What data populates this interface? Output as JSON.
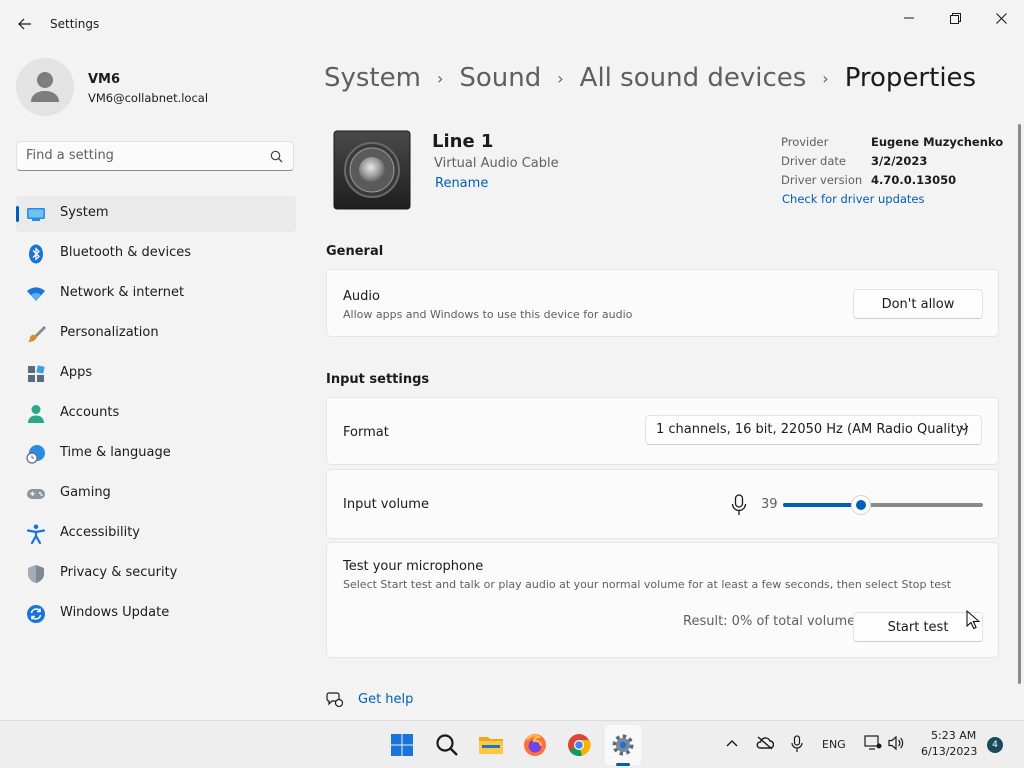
{
  "window": {
    "title": "Settings"
  },
  "profile": {
    "name": "VM6",
    "email": "VM6@collabnet.local"
  },
  "search": {
    "placeholder": "Find a setting"
  },
  "sidebar": {
    "items": [
      {
        "label": "System",
        "icon": "system-icon",
        "active": true
      },
      {
        "label": "Bluetooth & devices",
        "icon": "bluetooth-icon"
      },
      {
        "label": "Network & internet",
        "icon": "wifi-icon"
      },
      {
        "label": "Personalization",
        "icon": "brush-icon"
      },
      {
        "label": "Apps",
        "icon": "apps-icon"
      },
      {
        "label": "Accounts",
        "icon": "accounts-icon"
      },
      {
        "label": "Time & language",
        "icon": "globe-clock-icon"
      },
      {
        "label": "Gaming",
        "icon": "gamepad-icon"
      },
      {
        "label": "Accessibility",
        "icon": "accessibility-icon"
      },
      {
        "label": "Privacy & security",
        "icon": "shield-icon"
      },
      {
        "label": "Windows Update",
        "icon": "update-icon"
      }
    ]
  },
  "breadcrumb": {
    "items": [
      "System",
      "Sound",
      "All sound devices",
      "Properties"
    ],
    "separator": "›"
  },
  "device": {
    "name": "Line 1",
    "type": "Virtual Audio Cable",
    "rename_label": "Rename",
    "info": {
      "provider_label": "Provider",
      "provider_value": "Eugene Muzychenko",
      "date_label": "Driver date",
      "date_value": "3/2/2023",
      "version_label": "Driver version",
      "version_value": "4.70.0.13050"
    },
    "driver_link": "Check for driver updates"
  },
  "general": {
    "title": "General",
    "audio": {
      "title": "Audio",
      "description": "Allow apps and Windows to use this device for audio",
      "button_label": "Don't allow"
    }
  },
  "input_settings": {
    "title": "Input settings",
    "format": {
      "label": "Format",
      "value": "1 channels, 16 bit, 22050 Hz (AM Radio Quality)"
    },
    "volume": {
      "label": "Input volume",
      "value": "39",
      "level_percent": 39
    },
    "test": {
      "title": "Test your microphone",
      "description": "Select Start test and talk or play audio at your normal volume for at least a few seconds, then select Stop test",
      "result": "Result: 0% of total volume",
      "button_label": "Start test"
    }
  },
  "help": {
    "label": "Get help"
  },
  "taskbar": {
    "language": "ENG",
    "time": "5:23 AM",
    "date": "6/13/2023",
    "notification_count": "4"
  },
  "colors": {
    "accent": "#005fb8",
    "background": "#f3f3f3",
    "card": "#fbfbfb"
  }
}
